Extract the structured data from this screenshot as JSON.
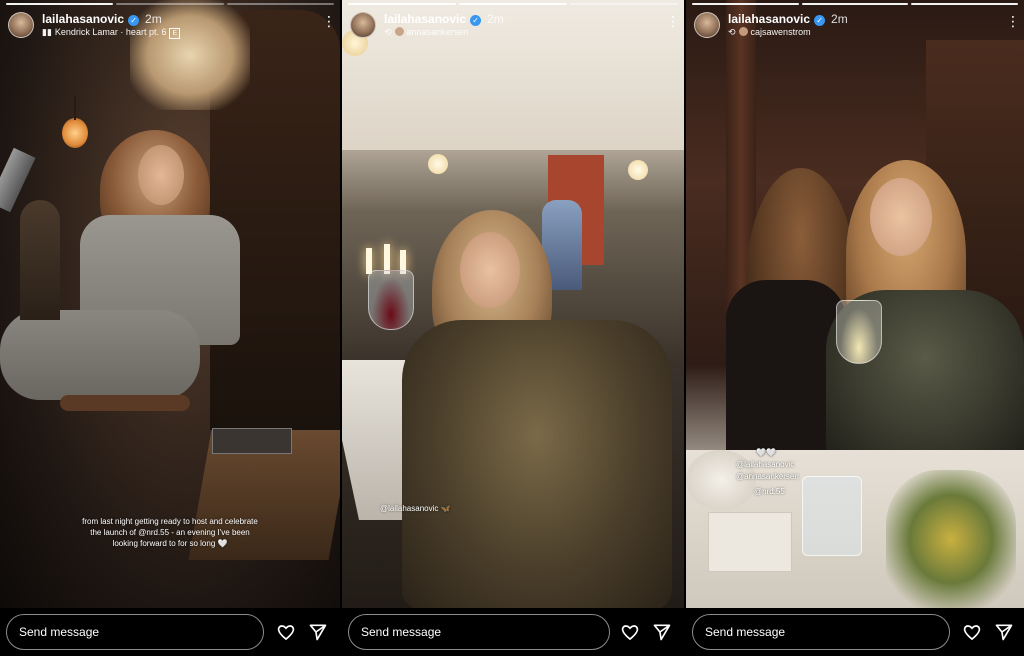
{
  "stories": [
    {
      "username": "lailahasanovic",
      "time": "2m",
      "music": "Kendrick Lamar · heart pt. 6",
      "explicit_badge": "E",
      "caption": "from last night getting ready to host and celebrate the launch of @nrd.55 - an evening I've been looking forward to for so long 🤍",
      "message_placeholder": "Send message"
    },
    {
      "username": "lailahasanovic",
      "time": "2m",
      "reshared_from": "annasankersen",
      "mention": "@lailahasanovic 🦋",
      "message_placeholder": "Send message"
    },
    {
      "username": "lailahasanovic",
      "time": "2m",
      "reshared_from": "cajsawenstrom",
      "hearts": "🤍🤍",
      "mentions": [
        "@lailahasanovic",
        "@annasankersen",
        "@nrd.55"
      ],
      "message_placeholder": "Send message"
    }
  ],
  "icons": {
    "more": "more-options-icon",
    "heart": "heart-icon",
    "send": "send-icon",
    "music": "music-icon",
    "reshare": "reshare-icon"
  },
  "colors": {
    "verified": "#3897f0",
    "background": "#000000"
  }
}
